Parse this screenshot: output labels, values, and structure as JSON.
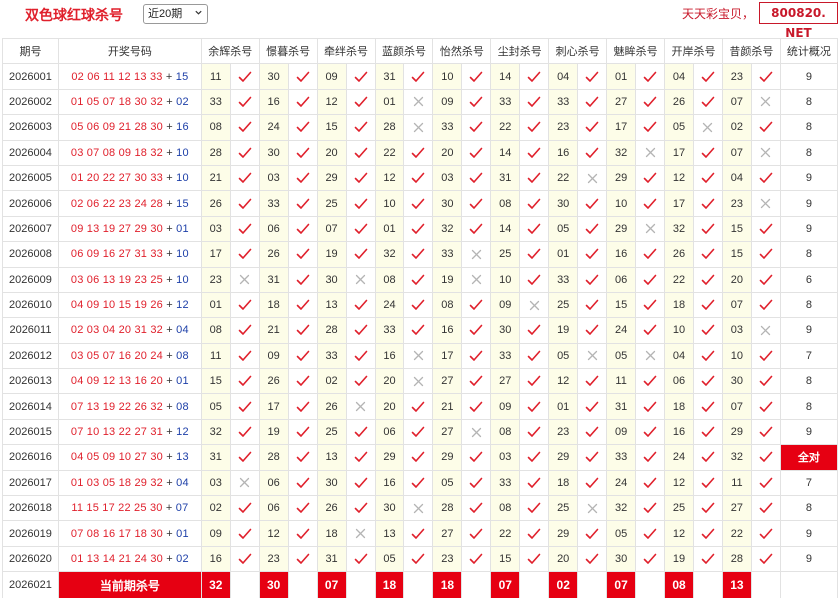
{
  "header": {
    "title": "双色球红球杀号",
    "period_select": "近20期",
    "brand_text": "天天彩宝贝，",
    "brand_url": "800820. NET"
  },
  "columns": [
    "期号",
    "开奖号码",
    "余辉杀号",
    "憬暮杀号",
    "牵绊杀号",
    "蓝颜杀号",
    "怡然杀号",
    "尘封杀号",
    "刺心杀号",
    "魅眸杀号",
    "开岸杀号",
    "昔颜杀号",
    "统计概况"
  ],
  "rows": [
    {
      "issue": "2026001",
      "reds": "02 06 11 12 13 33",
      "blue": "15",
      "kills": [
        [
          "11",
          1
        ],
        [
          "30",
          1
        ],
        [
          "09",
          1
        ],
        [
          "31",
          1
        ],
        [
          "10",
          1
        ],
        [
          "14",
          1
        ],
        [
          "04",
          1
        ],
        [
          "01",
          1
        ],
        [
          "04",
          1
        ],
        [
          "23",
          1
        ]
      ],
      "stat": "9"
    },
    {
      "issue": "2026002",
      "reds": "01 05 07 18 30 32",
      "blue": "02",
      "kills": [
        [
          "33",
          1
        ],
        [
          "16",
          1
        ],
        [
          "12",
          1
        ],
        [
          "01",
          0
        ],
        [
          "09",
          1
        ],
        [
          "33",
          1
        ],
        [
          "33",
          1
        ],
        [
          "27",
          1
        ],
        [
          "26",
          1
        ],
        [
          "07",
          0
        ]
      ],
      "stat": "8"
    },
    {
      "issue": "2026003",
      "reds": "05 06 09 21 28 30",
      "blue": "16",
      "kills": [
        [
          "08",
          1
        ],
        [
          "24",
          1
        ],
        [
          "15",
          1
        ],
        [
          "28",
          0
        ],
        [
          "33",
          1
        ],
        [
          "22",
          1
        ],
        [
          "23",
          1
        ],
        [
          "17",
          1
        ],
        [
          "05",
          0
        ],
        [
          "02",
          1
        ]
      ],
      "stat": "8"
    },
    {
      "issue": "2026004",
      "reds": "03 07 08 09 18 32",
      "blue": "10",
      "kills": [
        [
          "28",
          1
        ],
        [
          "30",
          1
        ],
        [
          "20",
          1
        ],
        [
          "22",
          1
        ],
        [
          "20",
          1
        ],
        [
          "14",
          1
        ],
        [
          "16",
          1
        ],
        [
          "32",
          0
        ],
        [
          "17",
          1
        ],
        [
          "07",
          0
        ]
      ],
      "stat": "8"
    },
    {
      "issue": "2026005",
      "reds": "01 20 22 27 30 33",
      "blue": "10",
      "kills": [
        [
          "21",
          1
        ],
        [
          "03",
          1
        ],
        [
          "29",
          1
        ],
        [
          "12",
          1
        ],
        [
          "03",
          1
        ],
        [
          "31",
          1
        ],
        [
          "22",
          0
        ],
        [
          "29",
          1
        ],
        [
          "12",
          1
        ],
        [
          "04",
          1
        ]
      ],
      "stat": "9"
    },
    {
      "issue": "2026006",
      "reds": "02 06 22 23 24 28",
      "blue": "15",
      "kills": [
        [
          "26",
          1
        ],
        [
          "33",
          1
        ],
        [
          "25",
          1
        ],
        [
          "10",
          1
        ],
        [
          "30",
          1
        ],
        [
          "08",
          1
        ],
        [
          "30",
          1
        ],
        [
          "10",
          1
        ],
        [
          "17",
          1
        ],
        [
          "23",
          0
        ]
      ],
      "stat": "9"
    },
    {
      "issue": "2026007",
      "reds": "09 13 19 27 29 30",
      "blue": "01",
      "kills": [
        [
          "03",
          1
        ],
        [
          "06",
          1
        ],
        [
          "07",
          1
        ],
        [
          "01",
          1
        ],
        [
          "32",
          1
        ],
        [
          "14",
          1
        ],
        [
          "05",
          1
        ],
        [
          "29",
          0
        ],
        [
          "32",
          1
        ],
        [
          "15",
          1
        ]
      ],
      "stat": "9"
    },
    {
      "issue": "2026008",
      "reds": "06 09 16 27 31 33",
      "blue": "10",
      "kills": [
        [
          "17",
          1
        ],
        [
          "26",
          1
        ],
        [
          "19",
          1
        ],
        [
          "32",
          1
        ],
        [
          "33",
          0
        ],
        [
          "25",
          1
        ],
        [
          "01",
          1
        ],
        [
          "16",
          1
        ],
        [
          "26",
          1
        ],
        [
          "15",
          1
        ]
      ],
      "stat": "8"
    },
    {
      "issue": "2026009",
      "reds": "03 06 13 19 23 25",
      "blue": "10",
      "kills": [
        [
          "23",
          0
        ],
        [
          "31",
          1
        ],
        [
          "30",
          0
        ],
        [
          "08",
          1
        ],
        [
          "19",
          0
        ],
        [
          "10",
          1
        ],
        [
          "33",
          1
        ],
        [
          "06",
          1
        ],
        [
          "22",
          1
        ],
        [
          "20",
          1
        ]
      ],
      "stat": "6"
    },
    {
      "issue": "2026010",
      "reds": "04 09 10 15 19 26",
      "blue": "12",
      "kills": [
        [
          "01",
          1
        ],
        [
          "18",
          1
        ],
        [
          "13",
          1
        ],
        [
          "24",
          1
        ],
        [
          "08",
          1
        ],
        [
          "09",
          0
        ],
        [
          "25",
          1
        ],
        [
          "15",
          1
        ],
        [
          "18",
          1
        ],
        [
          "07",
          1
        ]
      ],
      "stat": "8"
    },
    {
      "issue": "2026011",
      "reds": "02 03 04 20 31 32",
      "blue": "04",
      "kills": [
        [
          "08",
          1
        ],
        [
          "21",
          1
        ],
        [
          "28",
          1
        ],
        [
          "33",
          1
        ],
        [
          "16",
          1
        ],
        [
          "30",
          1
        ],
        [
          "19",
          1
        ],
        [
          "24",
          1
        ],
        [
          "10",
          1
        ],
        [
          "03",
          0
        ]
      ],
      "stat": "9"
    },
    {
      "issue": "2026012",
      "reds": "03 05 07 16 20 24",
      "blue": "08",
      "kills": [
        [
          "11",
          1
        ],
        [
          "09",
          1
        ],
        [
          "33",
          1
        ],
        [
          "16",
          0
        ],
        [
          "17",
          1
        ],
        [
          "33",
          1
        ],
        [
          "05",
          0
        ],
        [
          "05",
          0
        ],
        [
          "04",
          1
        ],
        [
          "10",
          1
        ]
      ],
      "stat": "7"
    },
    {
      "issue": "2026013",
      "reds": "04 09 12 13 16 20",
      "blue": "01",
      "kills": [
        [
          "15",
          1
        ],
        [
          "26",
          1
        ],
        [
          "02",
          1
        ],
        [
          "20",
          0
        ],
        [
          "27",
          1
        ],
        [
          "27",
          1
        ],
        [
          "12",
          1
        ],
        [
          "11",
          1
        ],
        [
          "06",
          1
        ],
        [
          "30",
          1
        ]
      ],
      "stat": "8"
    },
    {
      "issue": "2026014",
      "reds": "07 13 19 22 26 32",
      "blue": "08",
      "kills": [
        [
          "05",
          1
        ],
        [
          "17",
          1
        ],
        [
          "26",
          0
        ],
        [
          "20",
          1
        ],
        [
          "21",
          1
        ],
        [
          "09",
          1
        ],
        [
          "01",
          1
        ],
        [
          "31",
          1
        ],
        [
          "18",
          1
        ],
        [
          "07",
          1
        ]
      ],
      "stat": "8"
    },
    {
      "issue": "2026015",
      "reds": "07 10 13 22 27 31",
      "blue": "12",
      "kills": [
        [
          "32",
          1
        ],
        [
          "19",
          1
        ],
        [
          "25",
          1
        ],
        [
          "06",
          1
        ],
        [
          "27",
          0
        ],
        [
          "08",
          1
        ],
        [
          "23",
          1
        ],
        [
          "09",
          1
        ],
        [
          "16",
          1
        ],
        [
          "29",
          1
        ]
      ],
      "stat": "9"
    },
    {
      "issue": "2026016",
      "reds": "04 05 09 10 27 30",
      "blue": "13",
      "kills": [
        [
          "31",
          1
        ],
        [
          "28",
          1
        ],
        [
          "13",
          1
        ],
        [
          "29",
          1
        ],
        [
          "29",
          1
        ],
        [
          "03",
          1
        ],
        [
          "29",
          1
        ],
        [
          "33",
          1
        ],
        [
          "24",
          1
        ],
        [
          "32",
          1
        ]
      ],
      "stat": "全对"
    },
    {
      "issue": "2026017",
      "reds": "01 03 05 18 29 32",
      "blue": "04",
      "kills": [
        [
          "03",
          0
        ],
        [
          "06",
          1
        ],
        [
          "30",
          1
        ],
        [
          "16",
          1
        ],
        [
          "05",
          1
        ],
        [
          "33",
          1
        ],
        [
          "18",
          1
        ],
        [
          "24",
          1
        ],
        [
          "12",
          1
        ],
        [
          "11",
          1
        ]
      ],
      "stat": "7"
    },
    {
      "issue": "2026018",
      "reds": "11 15 17 22 25 30",
      "blue": "07",
      "kills": [
        [
          "02",
          1
        ],
        [
          "06",
          1
        ],
        [
          "26",
          1
        ],
        [
          "30",
          0
        ],
        [
          "28",
          1
        ],
        [
          "08",
          1
        ],
        [
          "25",
          0
        ],
        [
          "32",
          1
        ],
        [
          "25",
          1
        ],
        [
          "27",
          1
        ]
      ],
      "stat": "8"
    },
    {
      "issue": "2026019",
      "reds": "07 08 16 17 18 30",
      "blue": "01",
      "kills": [
        [
          "09",
          1
        ],
        [
          "12",
          1
        ],
        [
          "18",
          0
        ],
        [
          "13",
          1
        ],
        [
          "27",
          1
        ],
        [
          "22",
          1
        ],
        [
          "29",
          1
        ],
        [
          "05",
          1
        ],
        [
          "12",
          1
        ],
        [
          "22",
          1
        ]
      ],
      "stat": "9"
    },
    {
      "issue": "2026020",
      "reds": "01 13 14 21 24 30",
      "blue": "02",
      "kills": [
        [
          "16",
          1
        ],
        [
          "23",
          1
        ],
        [
          "31",
          1
        ],
        [
          "05",
          1
        ],
        [
          "23",
          1
        ],
        [
          "15",
          1
        ],
        [
          "20",
          1
        ],
        [
          "30",
          1
        ],
        [
          "19",
          1
        ],
        [
          "28",
          1
        ]
      ],
      "stat": "9"
    }
  ],
  "current": {
    "issue": "2026021",
    "label": "当前期杀号",
    "kills": [
      "32",
      "30",
      "07",
      "18",
      "18",
      "07",
      "02",
      "07",
      "08",
      "13"
    ]
  },
  "colors": {
    "red_ball": "#e0202c",
    "blue_ball": "#1d3fa8",
    "check": "#e0202c",
    "cross": "#b4b4b4",
    "highlight": "#e60012",
    "kill_cell_bg": "#fdfde8"
  },
  "icons": {
    "hit": "check-icon",
    "miss": "cross-icon"
  }
}
